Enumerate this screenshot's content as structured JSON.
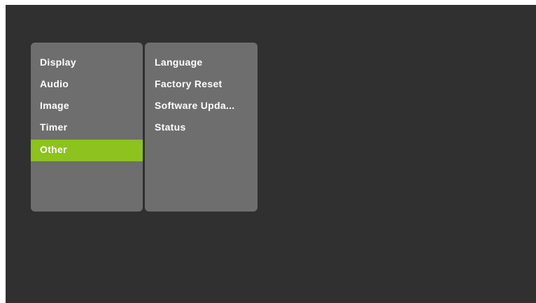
{
  "main_menu": {
    "items": [
      {
        "label": "Display"
      },
      {
        "label": "Audio"
      },
      {
        "label": "Image"
      },
      {
        "label": "Timer"
      },
      {
        "label": "Other"
      }
    ],
    "selected": "Other"
  },
  "sub_menu": {
    "items": [
      {
        "label": "Language"
      },
      {
        "label": "Factory Reset"
      },
      {
        "label": "Software Upda..."
      },
      {
        "label": "Status"
      }
    ]
  },
  "colors": {
    "background": "#303030",
    "panel": "#6e6e6e",
    "highlight": "#8dc21f",
    "text": "#ffffff"
  }
}
